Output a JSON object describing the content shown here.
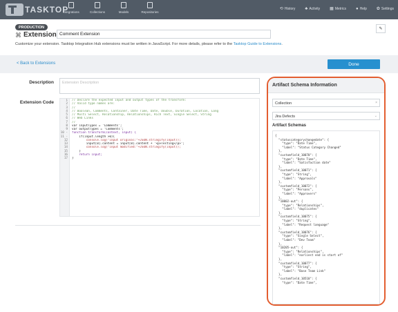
{
  "nav": {
    "logo_text": "TASKTOP",
    "left_items": [
      "Integrations",
      "Collections",
      "Models",
      "Repositories"
    ],
    "right_items": [
      {
        "icon": "history-icon",
        "glyph": "⟲",
        "label": "History"
      },
      {
        "icon": "activity-icon",
        "glyph": "♣",
        "label": "Activity"
      },
      {
        "icon": "metrics-icon",
        "glyph": "▦",
        "label": "Metrics"
      },
      {
        "icon": "help-icon",
        "glyph": "●",
        "label": "Help"
      },
      {
        "icon": "settings-icon",
        "glyph": "✿",
        "label": "Settings"
      }
    ],
    "bg_color": "#515b66"
  },
  "header": {
    "env_badge": "PRODUCTION",
    "title": "Extension",
    "name_value": "Comment Extension",
    "description_prefix": "Customize your extension. Tasktop Integration Hub extensions must be written in JavaScript. For more details, please refer to the ",
    "description_link": "Tasktop Guide to Extensions",
    "description_suffix": "."
  },
  "actions": {
    "back_label": "< Back to Extensions",
    "done_label": "Done",
    "accent_color": "#2790cf"
  },
  "form": {
    "description_label": "Description",
    "description_placeholder": "Extension Description",
    "code_label": "Extension Code",
    "line_numbers": [
      "1",
      "2",
      "3",
      "4",
      "5",
      "6",
      "7",
      "8",
      "9",
      "10 -",
      "11 -",
      "12",
      "13",
      "14",
      "15",
      "16",
      "17"
    ],
    "code_lines": [
      {
        "cls": "c-comment",
        "text": "// Declare the expected input and output types of the transform:"
      },
      {
        "cls": "c-comment",
        "text": "// Valid type names are:"
      },
      {
        "cls": "c-comment",
        "text": "//"
      },
      {
        "cls": "c-comment",
        "text": "// Boolean, Comments, Container, Date Time, Date, Double, Duration, Location, Long"
      },
      {
        "cls": "c-comment",
        "text": "// Multi Select, Relationship, Relationships, Rich Text, Single Select, String"
      },
      {
        "cls": "c-comment",
        "text": "// Web Links"
      },
      {
        "cls": "c-comment",
        "text": "//"
      },
      {
        "cls": "c-plain",
        "text": "var inputTypes = 'Comments';"
      },
      {
        "cls": "c-plain",
        "text": "var outputTypes = 'Comments';"
      },
      {
        "cls": "c-kw",
        "text": "function transform(context, input) {"
      },
      {
        "cls": "c-plain",
        "text": "    if(input.length >0){"
      },
      {
        "cls": "c-str",
        "text": "        console.log(\"input original:\"+JSON.stringify(input));"
      },
      {
        "cls": "c-plain",
        "text": "        input[0].content = input[0].content + '<p>Testing</p>';"
      },
      {
        "cls": "c-str",
        "text": "        console.log(\"input modified:\"+JSON.stringify(input));"
      },
      {
        "cls": "c-plain",
        "text": "    }"
      },
      {
        "cls": "c-kw",
        "text": "    return input;"
      },
      {
        "cls": "c-plain",
        "text": "}"
      }
    ]
  },
  "schema_panel": {
    "title": "Artifact Schema Information",
    "collection_value": "Collection",
    "artifact_value": "Jira Defects",
    "schemas_label": "Artifact Schemas",
    "border_color": "#e35d2f",
    "lines": [
      "{",
      "  \"statuscategorychangedate\": {",
      "    \"type\": \"Date Time\",",
      "    \"label\": \"Status Category Changed\"",
      "  },",
      "  \"customfield_10070\": {",
      "    \"type\": \"Date Time\",",
      "    \"label\": \"Satisfaction date\"",
      "  },",
      "  \"customfield_10071\": {",
      "    \"type\": \"String\",",
      "    \"label\": \"Approvals\"",
      "  },",
      "  \"customfield_10072\": {",
      "    \"type\": \"Persons\",",
      "    \"label\": \"Approvers\"",
      "  },",
      "  \"10002-out\": {",
      "    \"type\": \"Relationships\",",
      "    \"label\": \"duplicates\"",
      "  },",
      "  \"customfield_10075\": {",
      "    \"type\": \"String\",",
      "    \"label\": \"Request language\"",
      "  },",
      "  \"customfield_10076\": {",
      "    \"type\": \"Single Select\",",
      "    \"label\": \"Dev Team\"",
      "  },",
      "  \"10205-out\": {",
      "    \"type\": \"Relationships\",",
      "    \"label\": \"earliest end is start of\"",
      "  },",
      "  \"customfield_10077\": {",
      "    \"type\": \"String\",",
      "    \"label\": \"Base Team Link\"",
      "  },",
      "  \"customfield_10510\": {",
      "    \"type\": \"Date Time\","
    ]
  }
}
